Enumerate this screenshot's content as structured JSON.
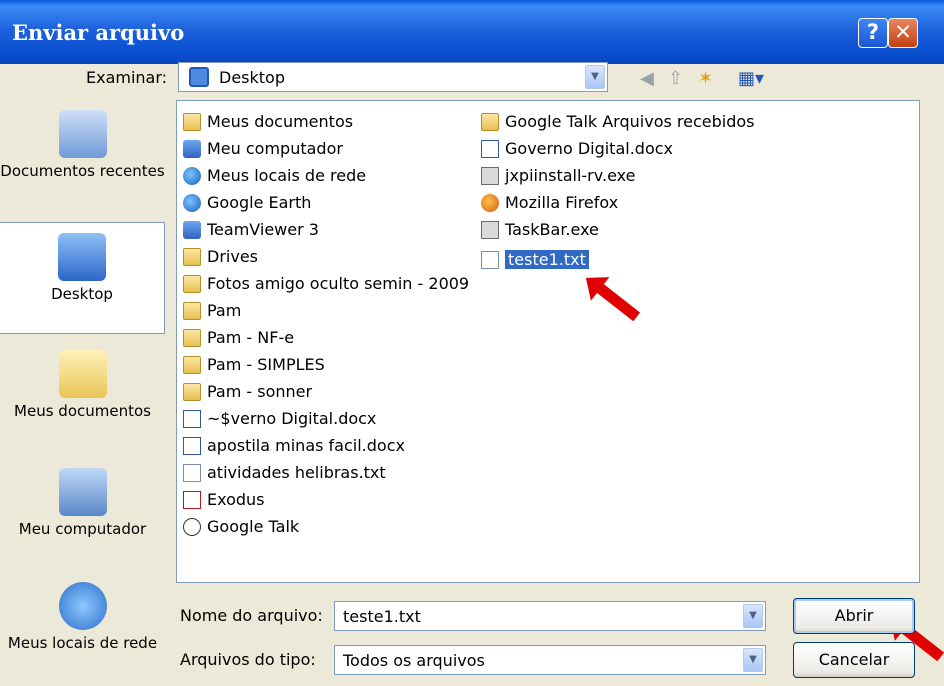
{
  "window": {
    "title": "Enviar arquivo",
    "help_glyph": "?",
    "close_glyph": "✕"
  },
  "toolbar": {
    "lookin_label": "Examinar:",
    "lookin_value": "Desktop",
    "back_glyph": "◀",
    "up_glyph": "⇧",
    "newfolder_glyph": "✶",
    "views_glyph": "▦▾"
  },
  "places": [
    {
      "label": "Documentos recentes",
      "icon": "recent-documents-icon"
    },
    {
      "label": "Desktop",
      "icon": "desktop-icon",
      "selected": true
    },
    {
      "label": "Meus documentos",
      "icon": "my-documents-icon"
    },
    {
      "label": "Meu computador",
      "icon": "my-computer-icon"
    },
    {
      "label": "Meus locais de rede",
      "icon": "network-places-icon"
    }
  ],
  "files": {
    "column1": [
      {
        "name": "Meus documentos",
        "icon": "folder-icon"
      },
      {
        "name": "Meu computador",
        "icon": "computer-icon"
      },
      {
        "name": "Meus locais de rede",
        "icon": "network-icon"
      },
      {
        "name": "Google Earth",
        "icon": "google-earth-icon"
      },
      {
        "name": "TeamViewer 3",
        "icon": "teamviewer-icon"
      },
      {
        "name": "Drives",
        "icon": "folder-icon"
      },
      {
        "name": "Fotos amigo oculto semin - 2009",
        "icon": "folder-icon"
      },
      {
        "name": "Pam",
        "icon": "folder-icon"
      },
      {
        "name": "Pam - NF-e",
        "icon": "folder-icon"
      },
      {
        "name": "Pam - SIMPLES",
        "icon": "folder-icon"
      },
      {
        "name": "Pam - sonner",
        "icon": "folder-icon"
      },
      {
        "name": "~$verno Digital.docx",
        "icon": "word-document-icon"
      },
      {
        "name": "apostila minas facil.docx",
        "icon": "word-document-icon"
      },
      {
        "name": "atividades helibras.txt",
        "icon": "text-file-icon"
      },
      {
        "name": "Exodus",
        "icon": "exodus-icon"
      },
      {
        "name": "Google Talk",
        "icon": "google-talk-icon"
      }
    ],
    "column2": [
      {
        "name": "Google Talk Arquivos recebidos",
        "icon": "folder-icon"
      },
      {
        "name": "Governo Digital.docx",
        "icon": "word-document-icon"
      },
      {
        "name": "jxpiinstall-rv.exe",
        "icon": "java-installer-icon"
      },
      {
        "name": "Mozilla Firefox",
        "icon": "firefox-icon"
      },
      {
        "name": "TaskBar.exe",
        "icon": "executable-icon"
      },
      {
        "name": "teste1.txt",
        "icon": "text-file-icon",
        "selected": true
      }
    ]
  },
  "filename": {
    "label": "Nome do arquivo:",
    "value": "teste1.txt"
  },
  "filetype": {
    "label": "Arquivos do tipo:",
    "value": "Todos os arquivos"
  },
  "buttons": {
    "open": "Abrir",
    "cancel": "Cancelar"
  },
  "dropdown_glyph": "▼"
}
